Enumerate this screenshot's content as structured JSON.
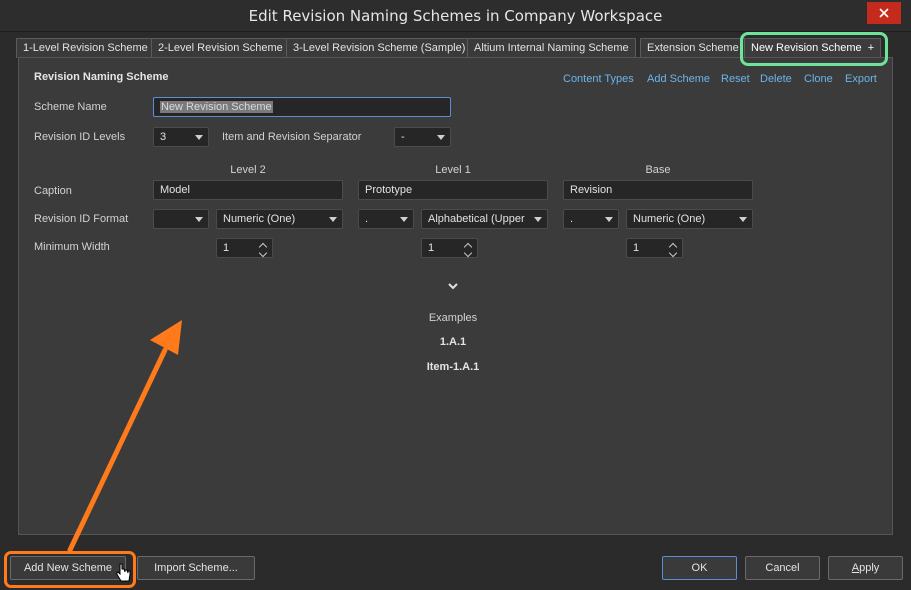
{
  "window": {
    "title": "Edit Revision Naming Schemes in Company Workspace"
  },
  "tabs": [
    {
      "label": "1-Level Revision Scheme"
    },
    {
      "label": "2-Level Revision Scheme"
    },
    {
      "label": "3-Level Revision Scheme (Sample)"
    },
    {
      "label": "Altium Internal Naming Scheme"
    },
    {
      "label": "Extension Scheme"
    },
    {
      "label": "New Revision Scheme",
      "suffix": "+"
    }
  ],
  "section": {
    "title": "Revision Naming Scheme"
  },
  "actions": [
    "Content Types",
    "Add Scheme",
    "Reset",
    "Delete",
    "Clone",
    "Export"
  ],
  "form": {
    "scheme_name_label": "Scheme Name",
    "scheme_name_value": "New Revision Scheme",
    "levels_label": "Revision ID Levels",
    "levels_value": "3",
    "separator_label": "Item and Revision Separator",
    "separator_value": "-",
    "caption_label": "Caption",
    "format_label": "Revision ID Format",
    "width_label": "Minimum Width"
  },
  "levels": [
    {
      "header": "Level 2",
      "caption": "Model",
      "separator": "",
      "format": "Numeric (One)",
      "min_width": "1"
    },
    {
      "header": "Level 1",
      "caption": "Prototype",
      "separator": ".",
      "format": "Alphabetical (Upper",
      "min_width": "1"
    },
    {
      "header": "Base",
      "caption": "Revision",
      "separator": ".",
      "format": "Numeric (One)",
      "min_width": "1"
    }
  ],
  "examples": {
    "title": "Examples",
    "items": [
      "1.A.1",
      "Item-1.A.1"
    ]
  },
  "footer": {
    "add_new": "Add New Scheme",
    "import": "Import Scheme...",
    "ok": "OK",
    "cancel": "Cancel",
    "apply_first": "A",
    "apply_rest": "pply"
  },
  "colors": {
    "tab_highlight": "#6ee39a",
    "arrow": "#ff7a1a",
    "link": "#6cb4ea",
    "close": "#c42b1c"
  }
}
